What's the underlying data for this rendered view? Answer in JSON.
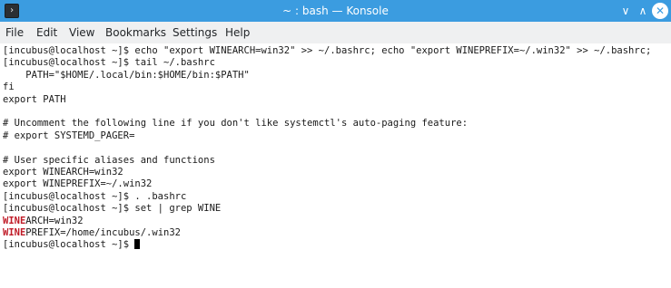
{
  "window": {
    "title": "~ : bash — Konsole",
    "app_icon_glyph": "›",
    "icon": "konsole-terminal-icon",
    "controls": {
      "minimize_glyph": "∨",
      "maximize_glyph": "∧",
      "close_glyph": "✕"
    },
    "accent_color": "#3b9ce0"
  },
  "menu": {
    "items": [
      "File",
      "Edit",
      "View",
      "Bookmarks",
      "Settings",
      "Help"
    ]
  },
  "terminal": {
    "lines": [
      "[incubus@localhost ~]$ echo \"export WINEARCH=win32\" >> ~/.bashrc; echo \"export WINEPREFIX=~/.win32\" >> ~/.bashrc;",
      "[incubus@localhost ~]$ tail ~/.bashrc",
      "    PATH=\"$HOME/.local/bin:$HOME/bin:$PATH\"",
      "fi",
      "export PATH",
      "",
      "# Uncomment the following line if you don't like systemctl's auto-paging feature:",
      "# export SYSTEMD_PAGER=",
      "",
      "# User specific aliases and functions",
      "export WINEARCH=win32",
      "export WINEPREFIX=~/.win32",
      "[incubus@localhost ~]$ . .bashrc",
      "[incubus@localhost ~]$ set | grep WINE"
    ],
    "grep_results": [
      {
        "match": "WINE",
        "rest": "ARCH=win32"
      },
      {
        "match": "WINE",
        "rest": "PREFIX=/home/incubus/.win32"
      }
    ],
    "prompt": "[incubus@localhost ~]$ ",
    "match_color": "#c01c28"
  }
}
